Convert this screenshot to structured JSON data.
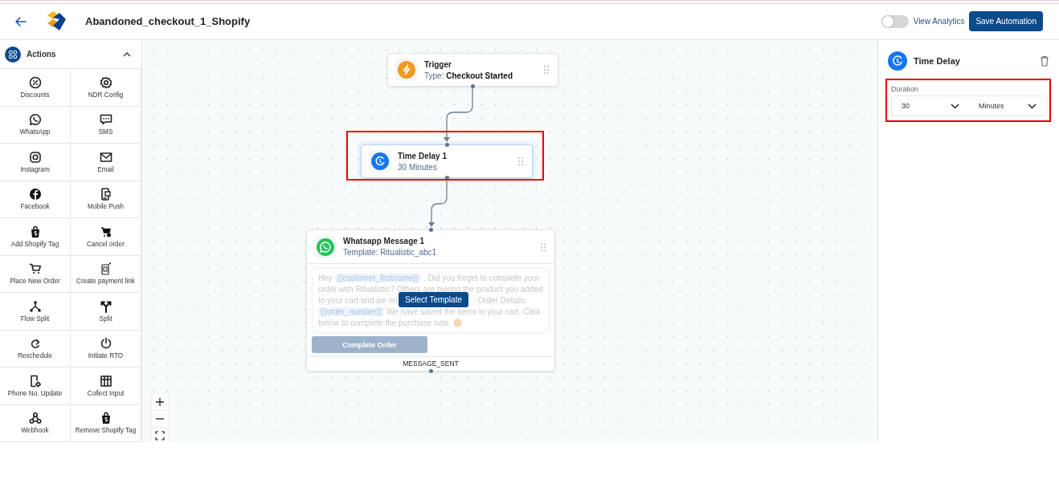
{
  "header": {
    "title": "Abandoned_checkout_1_Shopify",
    "analytics_toggle": {
      "label": "View Analytics",
      "on": false
    },
    "save_button": "Save Automation"
  },
  "sidebar": {
    "title": "Actions",
    "expanded": true,
    "items": [
      {
        "label": "Discounts"
      },
      {
        "label": "NDR Config"
      },
      {
        "label": "WhatsApp"
      },
      {
        "label": "SMS"
      },
      {
        "label": "Instagram"
      },
      {
        "label": "Email"
      },
      {
        "label": "Facebook"
      },
      {
        "label": "Mobile Push"
      },
      {
        "label": "Add Shopify Tag"
      },
      {
        "label": "Cancel order"
      },
      {
        "label": "Place New Order"
      },
      {
        "label": "Create payment link"
      },
      {
        "label": "Flow Split"
      },
      {
        "label": "Split"
      },
      {
        "label": "Reschedule"
      },
      {
        "label": "Initiate RTO"
      },
      {
        "label": "Phone No. Update"
      },
      {
        "label": "Collect Input"
      },
      {
        "label": "Webhook"
      },
      {
        "label": "Remove Shopify Tag"
      }
    ]
  },
  "canvas": {
    "nodes": [
      {
        "kind": "trigger",
        "title": "Trigger",
        "subtitle_label": "Type:",
        "subtitle_value": "Checkout Started",
        "highlighted": false
      },
      {
        "kind": "delay",
        "title": "Time Delay 1",
        "subtitle_value": "30 Minutes",
        "highlighted": true
      },
      {
        "kind": "message",
        "title": "Whatsapp Message 1",
        "subtitle_value": "Template: Ritualistic_abc1",
        "highlighted": false,
        "message_lines": [
          [
            {
              "kind": "text",
              "text": "Hey"
            },
            {
              "kind": "variable",
              "text": "{{customer_firstname}}"
            },
            {
              "kind": "text",
              "text": ", Did you forget to complete your"
            }
          ],
          [
            {
              "kind": "text",
              "text": "order with Ritualistic? Others are buying the product you added"
            }
          ],
          [
            {
              "kind": "text",
              "text": "to your cart and we mi"
            },
            {
              "kind": "gap"
            },
            {
              "kind": "text",
              "text": "Order Details:"
            }
          ],
          [
            {
              "kind": "variable",
              "text": "{{order_number}}"
            },
            {
              "kind": "text",
              "text": "We have saved the items in your cart. Click"
            }
          ],
          [
            {
              "kind": "text",
              "text": "below to complete the purchase now."
            },
            {
              "kind": "emoji"
            }
          ]
        ],
        "overlay_button": "Select Template",
        "action_button": {
          "label": "Complete Order",
          "disabled": true
        },
        "footer": "MESSAGE_SENT"
      }
    ]
  },
  "panel": {
    "title": "Time Delay",
    "duration": {
      "label": "Duration",
      "highlighted": true,
      "amount": "30",
      "unit": "Minutes"
    }
  }
}
